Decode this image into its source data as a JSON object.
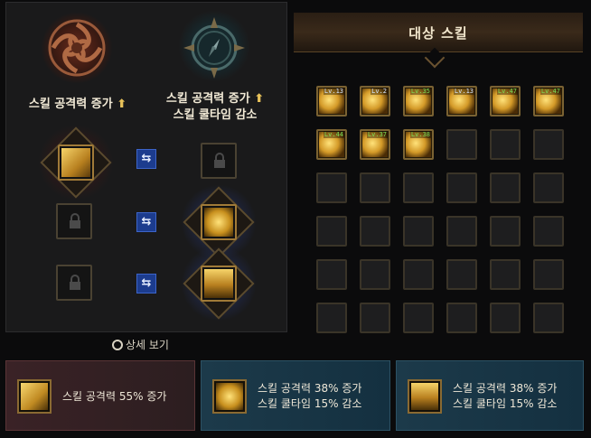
{
  "left_panel": {
    "type_left": {
      "line1": "스킬 공격력 증가",
      "arrow": "⬆"
    },
    "type_right": {
      "line1": "스킬 공격력 증가",
      "line2": "스킬 쿨타임 감소",
      "arrow": "⬆"
    },
    "rows": [
      {
        "left": "skill",
        "right": "locked"
      },
      {
        "left": "locked",
        "right": "skill"
      },
      {
        "left": "locked",
        "right": "skill"
      }
    ],
    "swap_symbol": "⇆",
    "detail_link": "상세 보기"
  },
  "target": {
    "title": "대상 스킬",
    "slots": [
      {
        "level": "Lv.13",
        "label_color": "white"
      },
      {
        "level": "Lv.2",
        "label_color": "white"
      },
      {
        "level": "Lv.35",
        "label_color": "green"
      },
      {
        "level": "Lv.13",
        "label_color": "white"
      },
      {
        "level": "Lv.47",
        "label_color": "green"
      },
      {
        "level": "Lv.47",
        "label_color": "green"
      },
      {
        "level": "Lv.44",
        "label_color": "green"
      },
      {
        "level": "Lv.37",
        "label_color": "green"
      },
      {
        "level": "Lv.38",
        "label_color": "green"
      }
    ],
    "empty_slot_count": 27
  },
  "cards": [
    {
      "text1": "스킬 공격력 55% 증가",
      "text2": ""
    },
    {
      "text1": "스킬 공격력 38% 증가",
      "text2": "스킬 쿨타임 15% 감소"
    },
    {
      "text1": "스킬 공격력 38% 증가",
      "text2": "스킬 쿨타임 15% 감소"
    }
  ],
  "colors": {
    "gold": "#e8c25a",
    "level_green": "#7de058",
    "swap_blue": "#1c3c8e"
  }
}
